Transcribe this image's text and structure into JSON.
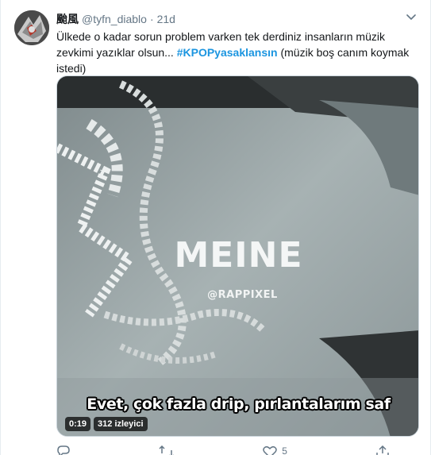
{
  "tweet": {
    "display_name": "颱風",
    "handle": "@tyfn_diablo",
    "separator": "·",
    "time": "21d",
    "text_part1": "Ülkede o kadar sorun problem varken tek derdiniz insanların müzik zevkimi yazıklar olsun... ",
    "hashtag": "#KPOPyasaklansın",
    "text_part2": " (müzik boş canım koymak istedi)"
  },
  "video": {
    "overlay_title": "MEINE",
    "overlay_credit": "@RAPPIXEL",
    "subtitle": "Evet, çok fazla drip, pırlantalarım saf",
    "duration": "0:19",
    "views": "312 izleyici"
  },
  "actions": {
    "reply_icon": "reply-icon",
    "retweet_icon": "retweet-icon",
    "like_icon": "heart-icon",
    "like_count": "5",
    "share_icon": "share-icon"
  },
  "colors": {
    "link": "#1b95e0",
    "secondary_text": "#657786",
    "primary_text": "#14171a"
  }
}
